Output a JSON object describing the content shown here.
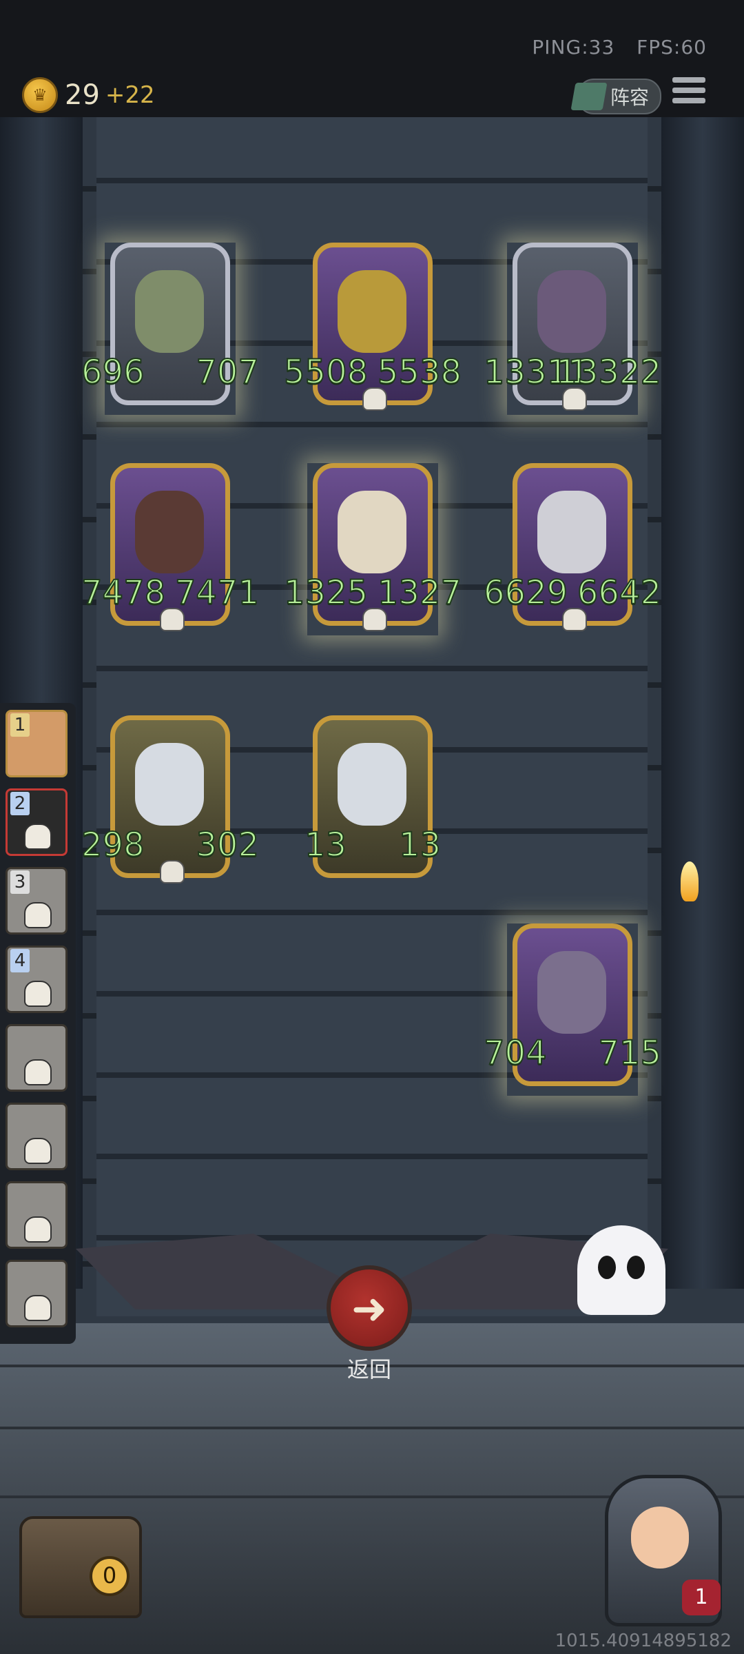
{
  "status": {
    "ping": "PING:33",
    "fps": "FPS:60"
  },
  "resources": {
    "gold": "29",
    "gold_bonus": "+22"
  },
  "header_buttons": {
    "lineup_label": "阵容"
  },
  "board": {
    "row1": [
      {
        "attack": "696",
        "health": "707"
      },
      {
        "attack": "5508",
        "health": "5538"
      },
      {
        "attack": "13311",
        "health": "13322"
      }
    ],
    "row2": [
      {
        "attack": "7478",
        "health": "7471"
      },
      {
        "attack": "1325",
        "health": "1327"
      },
      {
        "attack": "6629",
        "health": "6642"
      }
    ],
    "row3": [
      {
        "attack": "298",
        "health": "302"
      },
      {
        "attack": "13",
        "health": "13"
      }
    ],
    "row4": [
      {
        "attack": "704",
        "health": "715"
      }
    ]
  },
  "player_list": {
    "slot1": "1",
    "slot2": "2",
    "slot3": "3",
    "slot4": "4"
  },
  "actions": {
    "back_label": "返回"
  },
  "shop": {
    "count": "0"
  },
  "hero": {
    "lives": "1"
  },
  "coordinates": "1015.40914895182"
}
